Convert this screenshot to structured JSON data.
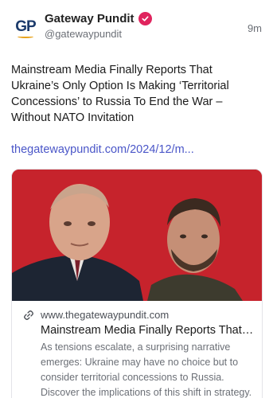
{
  "post": {
    "author": {
      "display_name": "Gateway Pundit",
      "handle": "@gatewaypundit",
      "avatar_text": "GP",
      "verified": true,
      "verified_color": "#e0245e"
    },
    "time": "9m",
    "text": "Mainstream Media Finally Reports That Ukraine’s Only Option Is Making ‘Territorial Concessions’ to Russia To End the War – Without NATO Invitation",
    "link_text": "thegatewaypundit.com/2024/12/m...",
    "link_color": "#4a56c8",
    "card": {
      "domain": "www.thegatewaypundit.com",
      "title": "Mainstream Media Finally Reports That Ukraine’s Only Option Is Making ‘Territorial Concessions’",
      "description": "As tensions escalate, a surprising narrative emerges: Ukraine may have no choice but to consider territorial concessions to Russia. Discover the implications of this shift in strategy.",
      "image_background": "#c6232c"
    }
  }
}
